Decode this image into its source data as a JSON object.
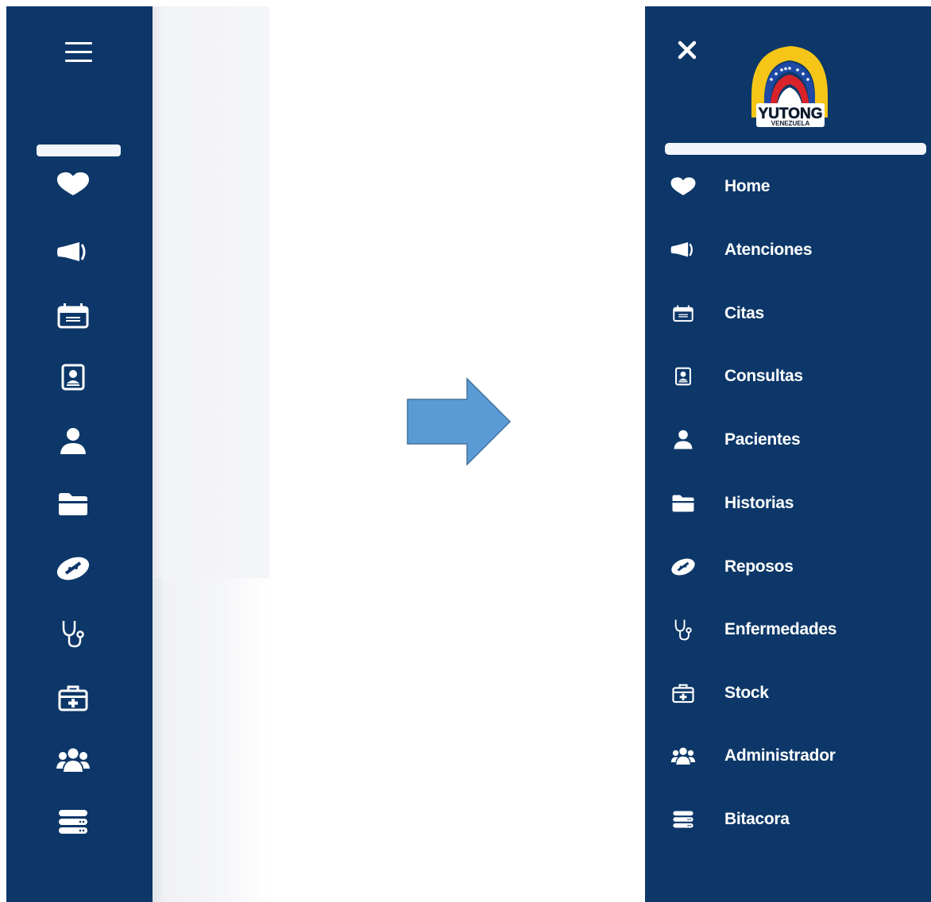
{
  "theme": {
    "sidebar_bg": "#0c3768",
    "icon_color": "#ffffff",
    "arrow_fill": "#5b9bd5",
    "arrow_stroke": "#41719c"
  },
  "collapsed_sidebar": {
    "menu_icon": "hamburger-icon",
    "icons": [
      "heart-icon",
      "megaphone-icon",
      "calendar-icon",
      "id-card-icon",
      "user-icon",
      "folder-icon",
      "bandage-icon",
      "stethoscope-icon",
      "first-aid-kit-icon",
      "users-icon",
      "server-icon"
    ]
  },
  "expanded_sidebar": {
    "close_icon": "close-icon",
    "logo": {
      "brand": "YUTONG",
      "subtitle": "VENEZUELA"
    },
    "menu": [
      {
        "label": "Home",
        "icon": "heart-icon"
      },
      {
        "label": "Atenciones",
        "icon": "megaphone-icon"
      },
      {
        "label": "Citas",
        "icon": "calendar-icon"
      },
      {
        "label": "Consultas",
        "icon": "id-card-icon"
      },
      {
        "label": "Pacientes",
        "icon": "user-icon"
      },
      {
        "label": "Historias",
        "icon": "folder-icon"
      },
      {
        "label": "Reposos",
        "icon": "bandage-icon"
      },
      {
        "label": "Enfermedades",
        "icon": "stethoscope-icon"
      },
      {
        "label": "Stock",
        "icon": "first-aid-kit-icon"
      },
      {
        "label": "Administrador",
        "icon": "users-icon"
      },
      {
        "label": "Bitacora",
        "icon": "server-icon"
      }
    ]
  },
  "transition_arrow": "right-arrow-icon"
}
